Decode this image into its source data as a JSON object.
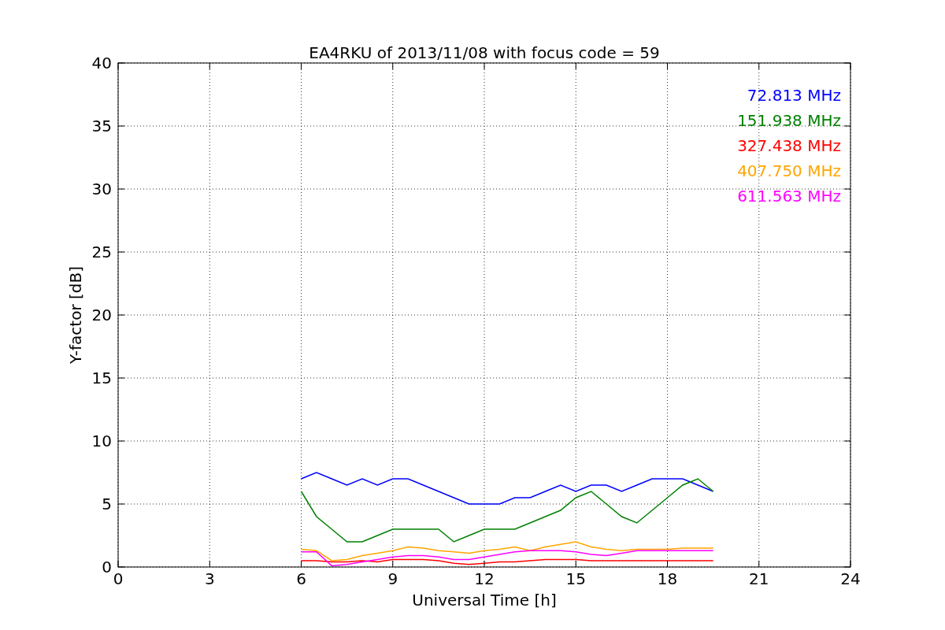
{
  "figure": {
    "chart_data": {
      "type": "line",
      "title": "EA4RKU of 2013/11/08 with focus code = 59",
      "xlabel": "Universal Time [h]",
      "ylabel": "Y-factor [dB]",
      "xlim": [
        0,
        24
      ],
      "ylim": [
        0,
        40
      ],
      "xticks": [
        0,
        3,
        6,
        9,
        12,
        15,
        18,
        21,
        24
      ],
      "yticks": [
        0,
        5,
        10,
        15,
        20,
        25,
        30,
        35,
        40
      ],
      "grid": true,
      "x": [
        6,
        6.5,
        7,
        7.5,
        8,
        8.5,
        9,
        9.5,
        10,
        10.5,
        11,
        11.5,
        12,
        12.5,
        13,
        13.5,
        14,
        14.5,
        15,
        15.5,
        16,
        16.5,
        17,
        17.5,
        18,
        18.5,
        19,
        19.5
      ],
      "series": [
        {
          "name": "72.813 MHz",
          "color": "#0000ff",
          "values": [
            7,
            7.5,
            7,
            6.5,
            7,
            6.5,
            7,
            7,
            6.5,
            6,
            5.5,
            5,
            5,
            5,
            5.5,
            5.5,
            6,
            6.5,
            6,
            6.5,
            6.5,
            6,
            6.5,
            7,
            7,
            7,
            6.5,
            6
          ]
        },
        {
          "name": "151.938 MHz",
          "color": "#008000",
          "values": [
            6,
            4,
            3,
            2,
            2,
            2.5,
            3,
            3,
            3,
            3,
            2,
            2.5,
            3,
            3,
            3,
            3.5,
            4,
            4.5,
            5.5,
            6,
            5,
            4,
            3.5,
            4.5,
            5.5,
            6.5,
            7,
            6
          ]
        },
        {
          "name": "327.438 MHz",
          "color": "#ff0000",
          "values": [
            0.5,
            0.5,
            0.4,
            0.4,
            0.5,
            0.4,
            0.6,
            0.6,
            0.6,
            0.5,
            0.3,
            0.2,
            0.3,
            0.4,
            0.4,
            0.5,
            0.6,
            0.6,
            0.6,
            0.5,
            0.5,
            0.5,
            0.5,
            0.5,
            0.5,
            0.5,
            0.5,
            0.5
          ]
        },
        {
          "name": "407.750 MHz",
          "color": "#ffa500",
          "values": [
            1.4,
            1.3,
            0.5,
            0.6,
            0.9,
            1.1,
            1.3,
            1.6,
            1.5,
            1.3,
            1.2,
            1.1,
            1.3,
            1.4,
            1.6,
            1.3,
            1.6,
            1.8,
            2,
            1.6,
            1.4,
            1.3,
            1.4,
            1.4,
            1.4,
            1.5,
            1.5,
            1.5
          ]
        },
        {
          "name": "611.563 MHz",
          "color": "#ff00ff",
          "values": [
            1.2,
            1.2,
            0.1,
            0.2,
            0.4,
            0.6,
            0.8,
            0.9,
            0.9,
            0.8,
            0.6,
            0.6,
            0.8,
            1,
            1.2,
            1.3,
            1.3,
            1.3,
            1.2,
            1,
            0.9,
            1.1,
            1.3,
            1.3,
            1.3,
            1.3,
            1.3,
            1.3
          ]
        }
      ]
    }
  }
}
